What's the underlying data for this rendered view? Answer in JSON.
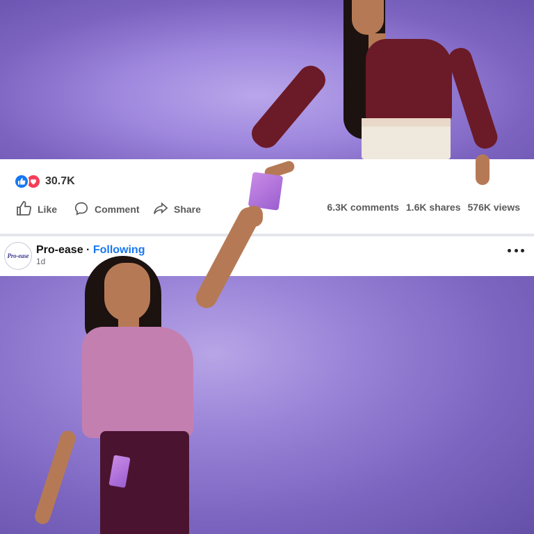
{
  "colors": {
    "background_purple": "#7c63c0",
    "facebook_blue": "#1877f2",
    "love_red": "#f33e58"
  },
  "reactions": {
    "icons": [
      "like-icon",
      "love-icon"
    ],
    "count": "30.7K"
  },
  "actions": {
    "like_label": "Like",
    "comment_label": "Comment",
    "share_label": "Share"
  },
  "stats": {
    "comments": "6.3K comments",
    "shares": "1.6K shares",
    "views": "576K views"
  },
  "post": {
    "page_name": "Pro-ease",
    "separator": "·",
    "follow_status": "Following",
    "time": "1d",
    "avatar_logo_text": "Pro-ease",
    "more_icon": "more-options-icon"
  }
}
